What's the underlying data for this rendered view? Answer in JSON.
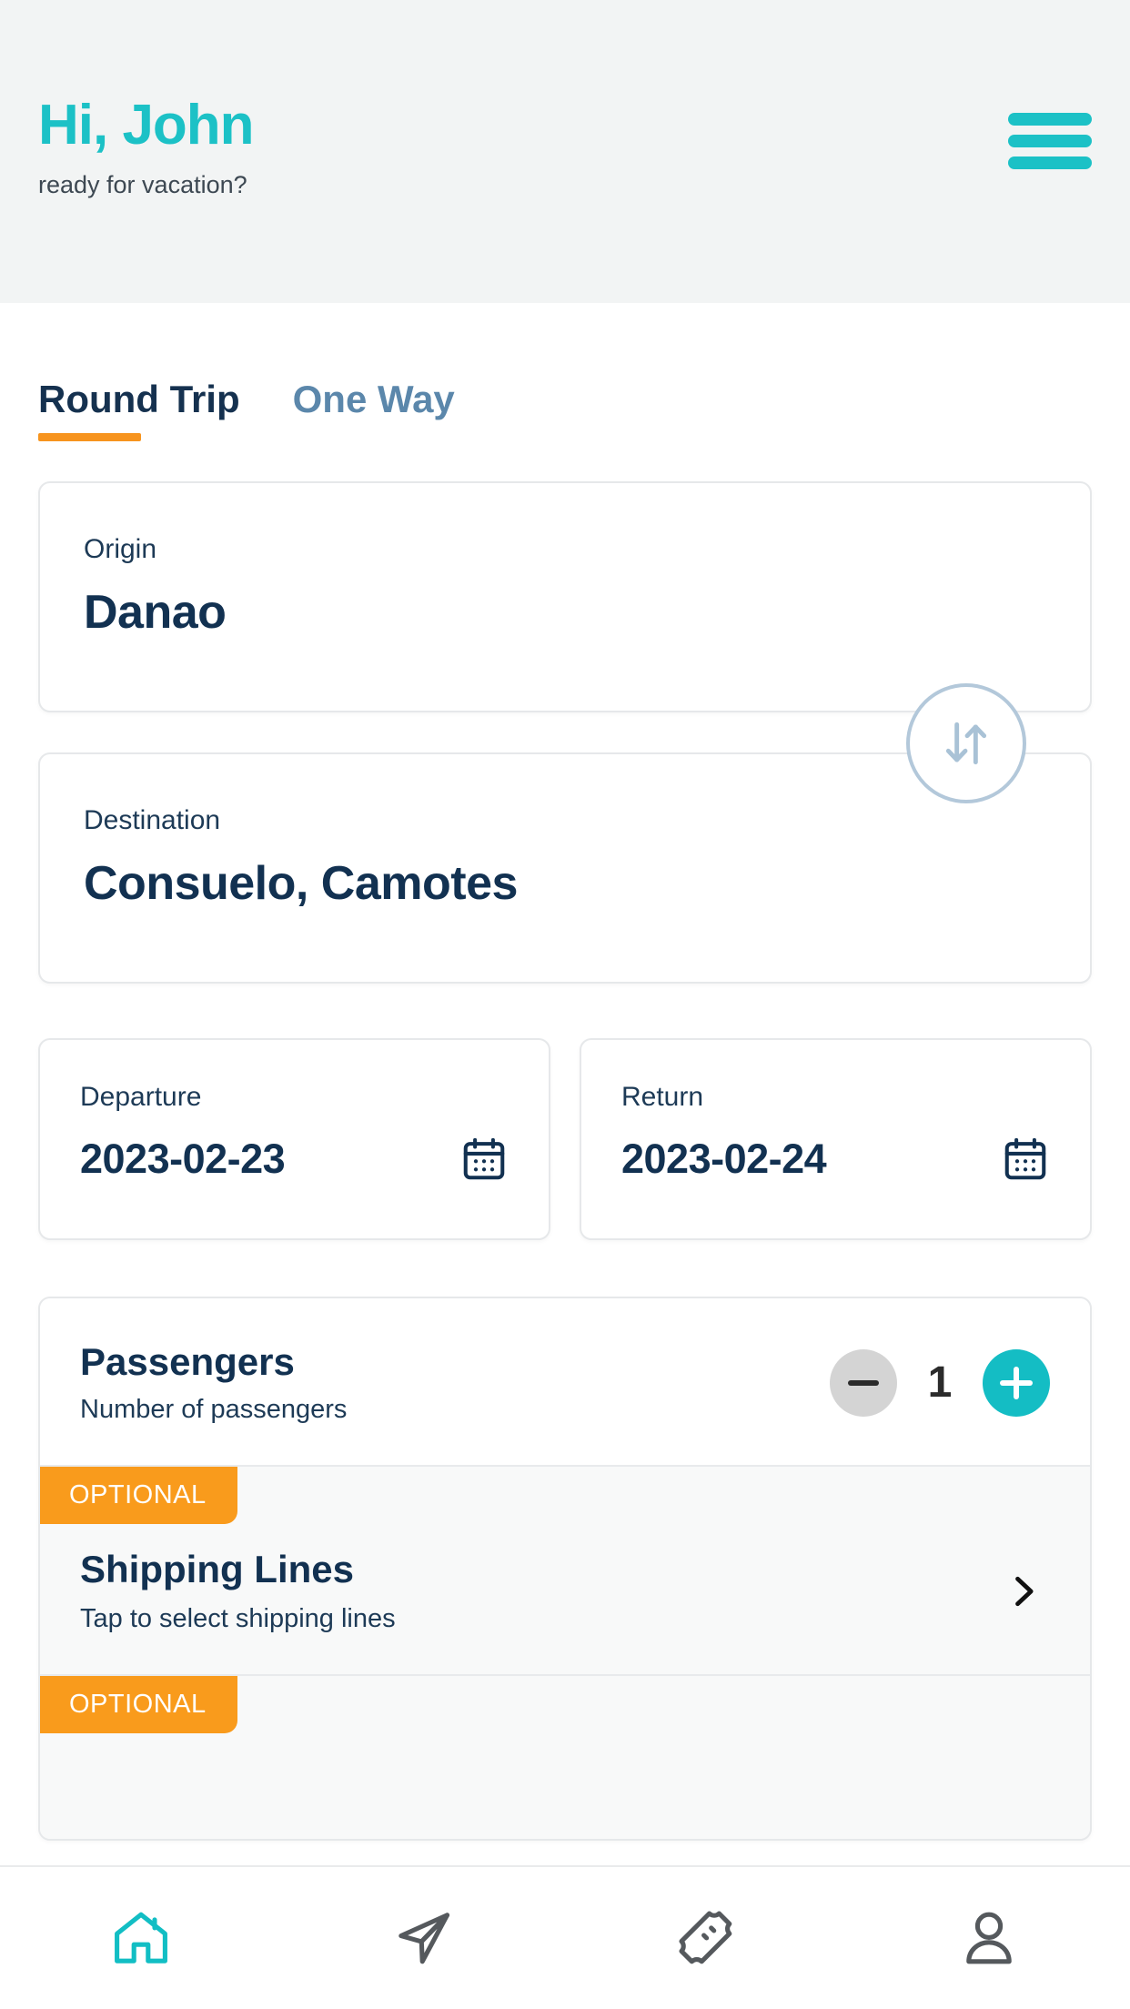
{
  "header": {
    "greeting": "Hi, John",
    "subgreeting": "ready for vacation?",
    "menu_label": "menu"
  },
  "tabs": [
    {
      "label": "Round Trip",
      "active": true
    },
    {
      "label": "One Way",
      "active": false
    }
  ],
  "search_form": {
    "origin": {
      "label": "Origin",
      "value": "Danao"
    },
    "destination": {
      "label": "Destination",
      "value": "Consuelo, Camotes"
    },
    "swap_label": "swap origin and destination",
    "departure": {
      "label": "Departure",
      "value": "2023-02-23"
    },
    "return": {
      "label": "Return",
      "value": "2023-02-24"
    }
  },
  "passengers": {
    "title": "Passengers",
    "subtitle": "Number of passengers",
    "count": "1",
    "decrement_label": "−",
    "increment_label": "+"
  },
  "options": [
    {
      "badge": "OPTIONAL",
      "title": "Shipping Lines",
      "subtitle": "Tap to select shipping lines"
    },
    {
      "badge": "OPTIONAL",
      "title": "",
      "subtitle": ""
    }
  ],
  "bottom_nav": [
    {
      "name": "home",
      "label": "Home",
      "active": true
    },
    {
      "name": "send",
      "label": "Trips",
      "active": false
    },
    {
      "name": "ticket",
      "label": "Tickets",
      "active": false
    },
    {
      "name": "profile",
      "label": "Profile",
      "active": false
    }
  ],
  "colors": {
    "brand_teal": "#1CC1C6",
    "accent_orange": "#F99B1C",
    "navy": "#123151",
    "muted_blue": "#5B87AB",
    "header_bg": "#F2F4F4"
  }
}
